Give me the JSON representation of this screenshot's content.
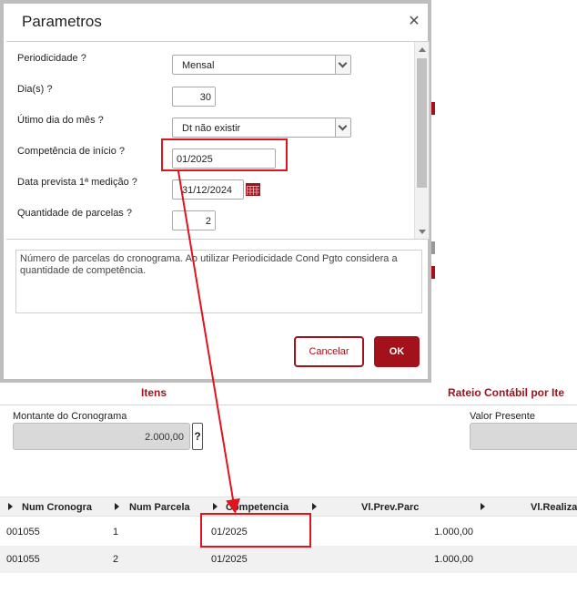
{
  "dialog": {
    "title": "Parametros",
    "close_symbol": "✕",
    "fields": {
      "periodicidade": {
        "label": "Periodicidade ?",
        "value": "Mensal"
      },
      "dias": {
        "label": "Dia(s) ?",
        "value": "30"
      },
      "ultimo_dia": {
        "label": "Útimo dia do mês ?",
        "value": "Dt não existir"
      },
      "competencia_inicio": {
        "label": "Competência de início ?",
        "value": "01/2025"
      },
      "data_prevista": {
        "label": "Data prevista 1ª medição ?",
        "value": "31/12/2024"
      },
      "qtd_parcelas": {
        "label": "Quantidade de parcelas ?",
        "value": "2"
      }
    },
    "help_text": "Número de parcelas do cronograma. Ao utilizar Periodicidade Cond Pgto considera a quantidade de competência.",
    "cancel_label": "Cancelar",
    "ok_label": "OK"
  },
  "background": {
    "section_itens": "Itens",
    "section_rateio": "Rateio Contábil por Ite",
    "montante_label": "Montante do Cronograma",
    "montante_value": "2.000,00",
    "help_symbol": "?",
    "valor_presente_label": "Valor Presente",
    "grid": {
      "headers": [
        "Num Cronogra",
        "Num Parcela",
        "Competencia",
        "Vl.Prev.Parc",
        "Vl.Realiza"
      ],
      "rows": [
        [
          "001055",
          "1",
          "01/2025",
          "1.000,00"
        ],
        [
          "001055",
          "2",
          "01/2025",
          "1.000,00"
        ]
      ]
    }
  },
  "colors": {
    "brand": "#a3121b",
    "annotation": "#e0141e"
  }
}
